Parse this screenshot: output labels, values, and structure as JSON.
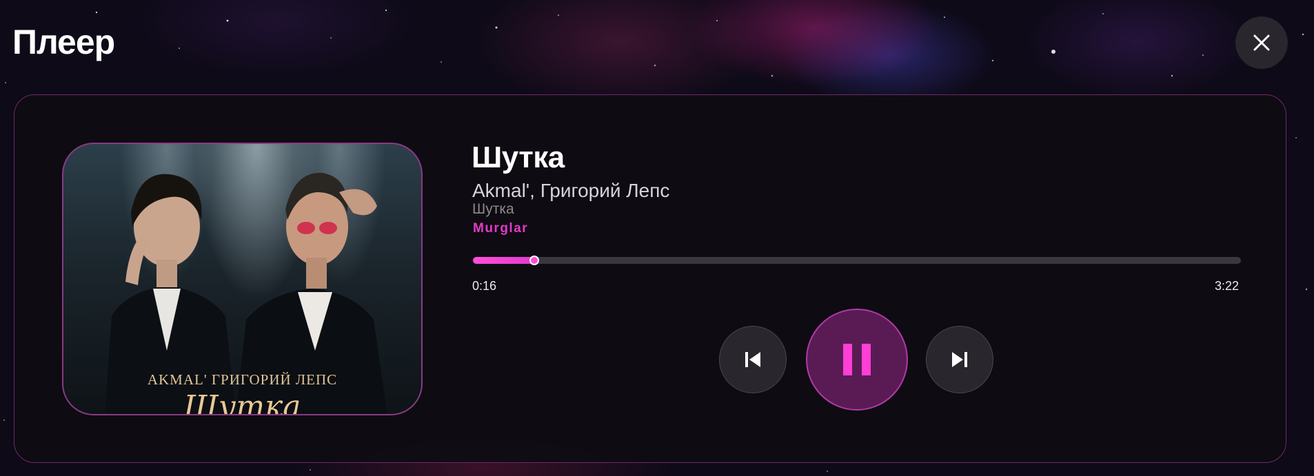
{
  "page": {
    "title": "Плеер"
  },
  "icons": {
    "close": "close-icon",
    "previous": "skip-previous-icon",
    "play_pause": "pause-icon",
    "next": "skip-next-icon"
  },
  "track": {
    "title": "Шутка",
    "artists": "Akmal', Григорий Лепс",
    "album": "Шутка",
    "source": "Murglar"
  },
  "cover": {
    "artists_text": "AKMAL'  ГРИГОРИЙ ЛЕПС",
    "title_text": "Шутка"
  },
  "playback": {
    "current_time": "0:16",
    "total_time": "3:22",
    "progress": 0.08,
    "state": "playing"
  },
  "colors": {
    "accent": "#e33ac8",
    "accent_bright": "#ff4fd8",
    "panel_border": "#6e2a68",
    "play_button_bg": "#5a1b55"
  }
}
